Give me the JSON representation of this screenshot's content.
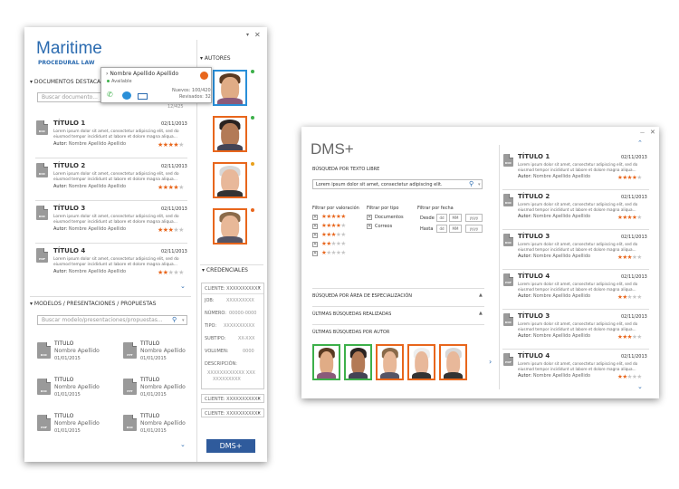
{
  "maritime": {
    "brand": "Maritime",
    "subtitle": "PROCEDURAL LAW",
    "docs_section": "DOCUMENTOS DESTACADOS",
    "search_placeholder": "Buscar documento...",
    "page_count": "12/425",
    "items": [
      {
        "title": "TÍTULO 1",
        "date": "02/11/2013",
        "desc1": "Lorem ipsum dolor sit amet, consectetur adipiscing elit, sed do",
        "desc2": "eiusmod tempor incididunt ut labore et dolore magna aliqua...",
        "author_label": "Autor:",
        "author": "Nombre Apellido Apellido",
        "type": "DOC",
        "rating": 4
      },
      {
        "title": "TÍTULO 2",
        "date": "02/11/2013",
        "desc1": "Lorem ipsum dolor sit amet, consectetur adipiscing elit, sed do",
        "desc2": "eiusmod tempor incididunt ut labore et dolore magna aliqua...",
        "author_label": "Autor:",
        "author": "Nombre Apellido Apellido",
        "type": "DOC",
        "rating": 4
      },
      {
        "title": "TÍTULO 3",
        "date": "02/11/2013",
        "desc1": "Lorem ipsum dolor sit amet, consectetur adipiscing elit, sed do",
        "desc2": "eiusmod tempor incididunt ut labore et dolore magna aliqua...",
        "author_label": "Autor:",
        "author": "Nombre Apellido Apellido",
        "type": "DOC",
        "rating": 3
      },
      {
        "title": "TÍTULO 4",
        "date": "02/11/2013",
        "desc1": "Lorem ipsum dolor sit amet, consectetur adipiscing elit, sed do",
        "desc2": "eiusmod tempor incididunt ut labore et dolore magna aliqua...",
        "author_label": "Autor:",
        "author": "Nombre Apellido Apellido",
        "type": "PDF",
        "rating": 2
      }
    ],
    "models_section": "MODELOS / PRESENTACIONES / PROPUESTAS",
    "models_placeholder": "Buscar modelo/presentaciones/propuestas...",
    "models": [
      {
        "title": "TITULO",
        "author": "Nombre Apellido",
        "date": "01/01/2015",
        "type": "DOC"
      },
      {
        "title": "TITULO",
        "author": "Nombre Apellido",
        "date": "01/01/2015",
        "type": "PPT"
      },
      {
        "title": "TITULO",
        "author": "Nombre Apellido",
        "date": "01/01/2015",
        "type": "DOC"
      },
      {
        "title": "TITULO",
        "author": "Nombre Apellido",
        "date": "01/01/2015",
        "type": "PPT"
      },
      {
        "title": "TITULO",
        "author": "Nombre Apellido",
        "date": "01/01/2015",
        "type": "PDF"
      },
      {
        "title": "TITULO",
        "author": "Nombre Apellido",
        "date": "01/01/2015",
        "type": "DOC"
      }
    ],
    "authors_section": "AUTORES",
    "popup": {
      "name": "Nombre Apellido Apellido",
      "status": "Available",
      "nuevos": "Nuevos: 100/420",
      "revisados": "Revisados: 32"
    },
    "credentials_section": "CREDENCIALES",
    "cred": {
      "cliente": "CLIENTE: XXXXXXXXXXX",
      "job_l": "JOB:",
      "job_v": "XXXXXXXXX",
      "num_l": "NÚMERO:",
      "num_v": "00000-0000",
      "tipo_l": "TIPO:",
      "tipo_v": "XXXXXXXXXX",
      "sub_l": "SUBTIPO:",
      "sub_v": "XX-XXX",
      "vol_l": "VOLUMEN:",
      "vol_v": "0000",
      "desc_l": "DESCRIPCIÓN:",
      "desc_v1": "XXXXXXXXXXXX XXX",
      "desc_v2": "XXXXXXXXX"
    },
    "cliente2": "CLIENTE: XXXXXXXXXXX",
    "cliente3": "CLIENTE: XXXXXXXXXXX",
    "dms_button": "DMS+",
    "colors": {
      "accent": "#2b6bb0",
      "orange": "#e8661c",
      "green": "#3db04a"
    }
  },
  "dms": {
    "title": "DMS+",
    "free_search_label": "BÚSQUEDA POR TEXTO LIBRE",
    "free_search_value": "Lorem ipsum dolor sit amet, consectetur adipiscing elit.",
    "filter_rating": "Filtrar por valoración",
    "filter_type": "Filtrar por tipo",
    "filter_date": "Filtrar por fecha",
    "type_docs": "Documentos",
    "type_mail": "Correos",
    "desde": "Desde",
    "hasta": "Hasta",
    "dd": "dd",
    "mm": "MM",
    "yyyy": "yyyy",
    "area_section": "BÚSQUEDA POR ÁREA DE ESPECIALIZACIÓN",
    "recent_section": "ÚLTIMAS BÚSQUEDAS REALIZADAS",
    "by_author_section": "ÚLTIMAS BÚSQUEDAS POR AUTOR",
    "results": [
      {
        "title": "TÍTULO 1",
        "date": "02/11/2013",
        "desc1": "Lorem ipsum dolor sit amet, consectetur adipiscing elit, sed do",
        "desc2": "eiusmod tempor incididunt ut labore et dolore magna aliqua...",
        "author_label": "Autor:",
        "author": "Nombre Apellido Apellido",
        "type": "DOC",
        "rating": 4
      },
      {
        "title": "TÍTULO 2",
        "date": "02/11/2013",
        "desc1": "Lorem ipsum dolor sit amet, consectetur adipiscing elit, sed do",
        "desc2": "eiusmod tempor incididunt ut labore et dolore magna aliqua...",
        "author_label": "Autor:",
        "author": "Nombre Apellido Apellido",
        "type": "DOC",
        "rating": 4
      },
      {
        "title": "TÍTULO 3",
        "date": "02/11/2013",
        "desc1": "Lorem ipsum dolor sit amet, consectetur adipiscing elit, sed do",
        "desc2": "eiusmod tempor incididunt ut labore et dolore magna aliqua...",
        "author_label": "Autor:",
        "author": "Nombre Apellido Apellido",
        "type": "DOC",
        "rating": 3
      },
      {
        "title": "TÍTULO 4",
        "date": "02/11/2013",
        "desc1": "Lorem ipsum dolor sit amet, consectetur adipiscing elit, sed do",
        "desc2": "eiusmod tempor incididunt ut labore et dolore magna aliqua...",
        "author_label": "Autor:",
        "author": "Nombre Apellido Apellido",
        "type": "PDF",
        "rating": 2
      },
      {
        "title": "TÍTULO 3",
        "date": "02/11/2013",
        "desc1": "Lorem ipsum dolor sit amet, consectetur adipiscing elit, sed do",
        "desc2": "eiusmod tempor incididunt ut labore et dolore magna aliqua...",
        "author_label": "Autor:",
        "author": "Nombre Apellido Apellido",
        "type": "DOC",
        "rating": 3
      },
      {
        "title": "TÍTULO 4",
        "date": "02/11/2013",
        "desc1": "Lorem ipsum dolor sit amet, consectetur adipiscing elit, sed do",
        "desc2": "eiusmod tempor incididunt ut labore et dolore magna aliqua...",
        "author_label": "Autor:",
        "author": "Nombre Apellido Apellido",
        "type": "PDF",
        "rating": 2
      }
    ]
  }
}
